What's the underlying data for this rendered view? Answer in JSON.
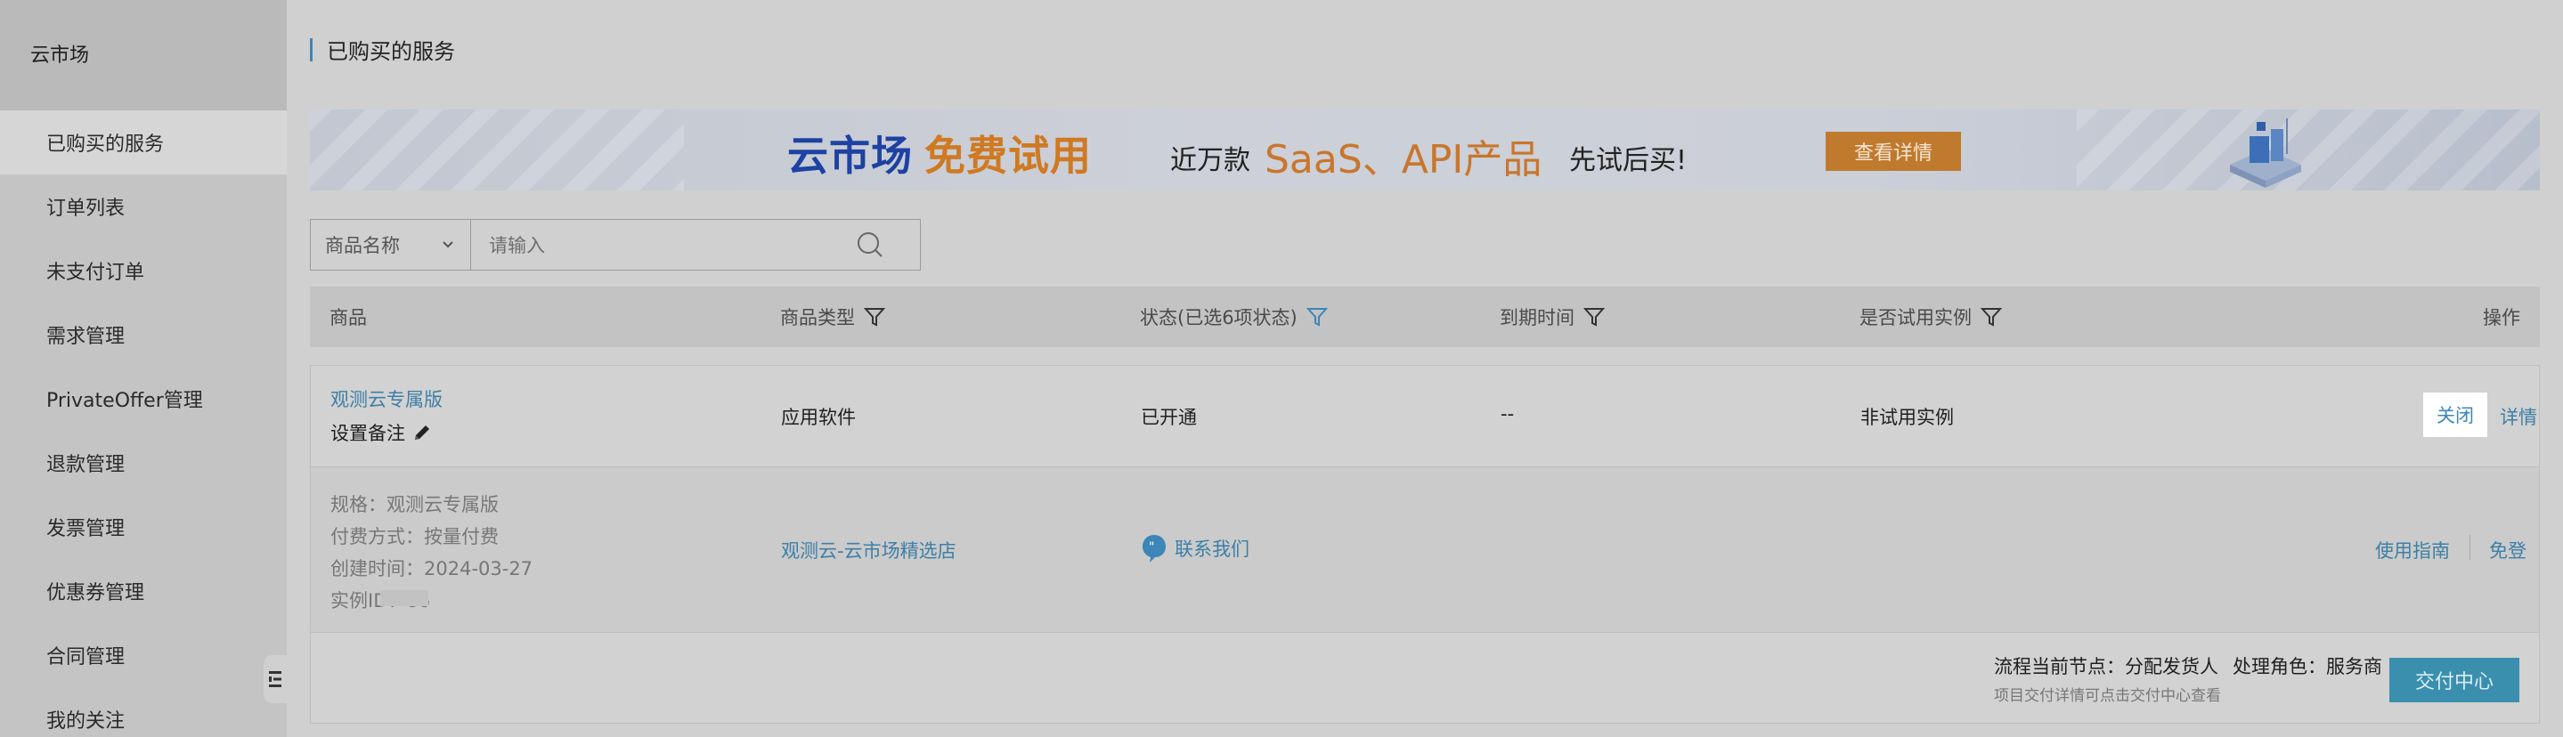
{
  "sidebar": {
    "title": "云市场",
    "items": [
      {
        "label": "已购买的服务",
        "active": true
      },
      {
        "label": "订单列表"
      },
      {
        "label": "未支付订单"
      },
      {
        "label": "需求管理"
      },
      {
        "label": "PrivateOffer管理"
      },
      {
        "label": "退款管理"
      },
      {
        "label": "发票管理"
      },
      {
        "label": "优惠券管理"
      },
      {
        "label": "合同管理"
      },
      {
        "label": "我的关注"
      }
    ]
  },
  "page": {
    "title": "已购买的服务"
  },
  "banner": {
    "brand": "云市场",
    "free": "免费试用",
    "pre": "近万款",
    "highlight": "SaaS、API产品",
    "post": "先试后买!",
    "button": "查看详情"
  },
  "search": {
    "select_label": "商品名称",
    "placeholder": "请输入"
  },
  "table": {
    "headers": {
      "product": "商品",
      "type": "商品类型",
      "status": "状态(已选6项状态)",
      "expiry": "到期时间",
      "trial": "是否试用实例",
      "actions": "操作"
    },
    "row": {
      "product_name": "观测云专属版",
      "note_label": "设置备注",
      "type": "应用软件",
      "status": "已开通",
      "expiry": "--",
      "trial": "非试用实例",
      "close_label": "关闭",
      "detail_label": "详情"
    },
    "detail": {
      "spec": "规格：观测云专属版",
      "pay": "付费方式：按量付费",
      "created": "创建时间：2024-03-27",
      "instance": "实例ID：86",
      "store": "观测云-云市场精选店",
      "contact": "联系我们",
      "guide": "使用指南",
      "sso": "免登"
    },
    "process": {
      "node": "流程当前节点：分配发货人",
      "role": "处理角色：服务商",
      "hint": "项目交付详情可点击交付中心查看",
      "button": "交付中心"
    }
  },
  "colors": {
    "accent": "#3d7fa6",
    "banner_button": "#c07a2e",
    "deliver_button": "#3a8fae"
  }
}
